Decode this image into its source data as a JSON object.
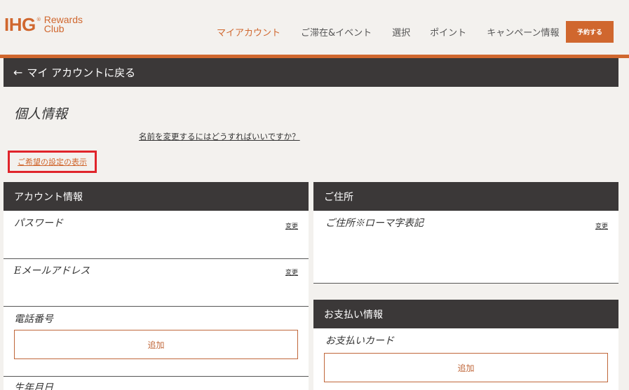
{
  "brand": {
    "logo_main": "IHG",
    "logo_reg": "®",
    "logo_line1": "Rewards",
    "logo_line2": "Club",
    "accent_color": "#d0672e"
  },
  "nav": {
    "items": [
      {
        "label": "マイアカウント",
        "active": true
      },
      {
        "label": "ご滞在&イベント",
        "active": false
      },
      {
        "label": "選択",
        "active": false
      },
      {
        "label": "ポイント",
        "active": false
      },
      {
        "label": "キャンペーン情報",
        "active": false
      }
    ],
    "book_label": "予約する"
  },
  "back": {
    "arrow_icon": "arrow-left-icon",
    "arrow_glyph": "←",
    "label": "マイ アカウントに戻る"
  },
  "page": {
    "title": "個人情報",
    "name_change_link": "名前を変更するにはどうすればいいですか？",
    "preferences_link": "ご希望の設定の表示"
  },
  "account_panel": {
    "header": "アカウント情報",
    "password_label": "パスワード",
    "password_change": "変更",
    "email_label": "Eメールアドレス",
    "email_change": "変更",
    "phone_label": "電話番号",
    "phone_add": "追加",
    "birthday_label": "生年月日"
  },
  "address_panel": {
    "header": "ご住所",
    "address_label": "ご住所※ローマ字表記",
    "address_change": "変更"
  },
  "payment_panel": {
    "header": "お支払い情報",
    "card_label": "お支払いカード",
    "card_add": "追加"
  }
}
